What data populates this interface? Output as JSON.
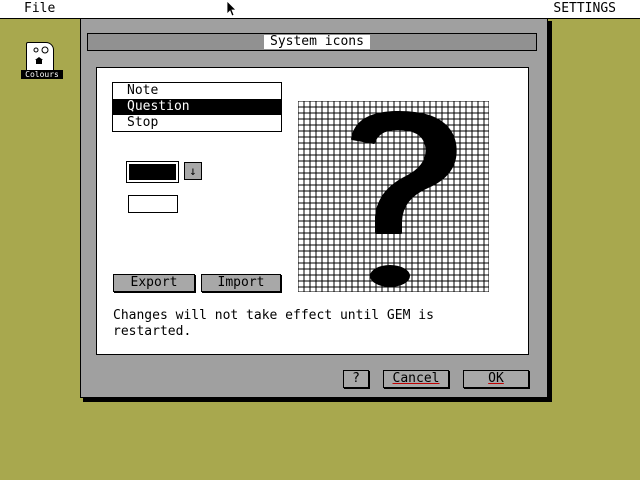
{
  "menubar": {
    "file": "File",
    "settings": "SETTINGS"
  },
  "desktop_icon": {
    "label": "Colours",
    "icon": "colours-icon"
  },
  "dialog": {
    "title": "System icons",
    "list": [
      {
        "label": "Note",
        "selected": false
      },
      {
        "label": "Question",
        "selected": true
      },
      {
        "label": "Stop",
        "selected": false
      }
    ],
    "color_value": "#000000",
    "dropdown_icon": "arrow-down-icon",
    "text_field_value": "",
    "export_label": "Export",
    "import_label": "Import",
    "message_line1": "Changes will not take effect until GEM is",
    "message_line2": "restarted.",
    "preview_icon": "question-mark-icon",
    "help_label": "?",
    "cancel_label": "Cancel",
    "ok_label": "OK"
  },
  "colors": {
    "desktop": "#a8a84e",
    "dialog_frame": "#a0a0a0",
    "button": "#a8a8a8"
  }
}
